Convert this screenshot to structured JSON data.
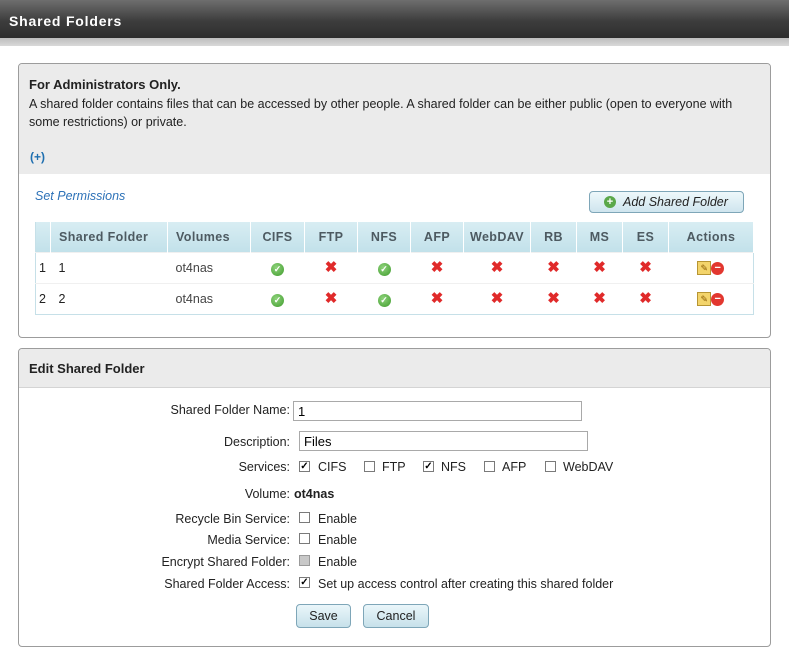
{
  "header": {
    "title": "Shared Folders"
  },
  "admin": {
    "title": "For Administrators Only.",
    "description": "A shared folder contains files that can be accessed by other people. A shared folder can be either public (open to everyone with some restrictions) or private.",
    "expand_link": "(+)"
  },
  "permissions": {
    "set_permissions_link": "Set Permissions",
    "add_button": "Add Shared Folder"
  },
  "table": {
    "columns": [
      "Shared Folder",
      "Volumes",
      "CIFS",
      "FTP",
      "NFS",
      "AFP",
      "WebDAV",
      "RB",
      "MS",
      "ES",
      "Actions"
    ],
    "rows": [
      {
        "index": "1",
        "name": "1",
        "volume": "ot4nas",
        "cifs": true,
        "ftp": false,
        "nfs": true,
        "afp": false,
        "webdav": false,
        "rb": false,
        "ms": false,
        "es": false
      },
      {
        "index": "2",
        "name": "2",
        "volume": "ot4nas",
        "cifs": true,
        "ftp": false,
        "nfs": true,
        "afp": false,
        "webdav": false,
        "rb": false,
        "ms": false,
        "es": false
      }
    ]
  },
  "edit": {
    "title": "Edit Shared Folder",
    "name_label": "Shared Folder Name:",
    "name_value": "1",
    "description_label": "Description:",
    "description_value": "Files",
    "services_label": "Services:",
    "services": [
      {
        "label": "CIFS",
        "checked": true
      },
      {
        "label": "FTP",
        "checked": false
      },
      {
        "label": "NFS",
        "checked": true
      },
      {
        "label": "AFP",
        "checked": false
      },
      {
        "label": "WebDAV",
        "checked": false
      }
    ],
    "volume_label": "Volume:",
    "volume_value": "ot4nas",
    "recycle_label": "Recycle Bin Service:",
    "recycle_option": "Enable",
    "media_label": "Media Service:",
    "media_option": "Enable",
    "encrypt_label": "Encrypt Shared Folder:",
    "encrypt_option": "Enable",
    "access_label": "Shared Folder Access:",
    "access_option": "Set up access control after creating this shared folder",
    "save_button": "Save",
    "cancel_button": "Cancel"
  }
}
